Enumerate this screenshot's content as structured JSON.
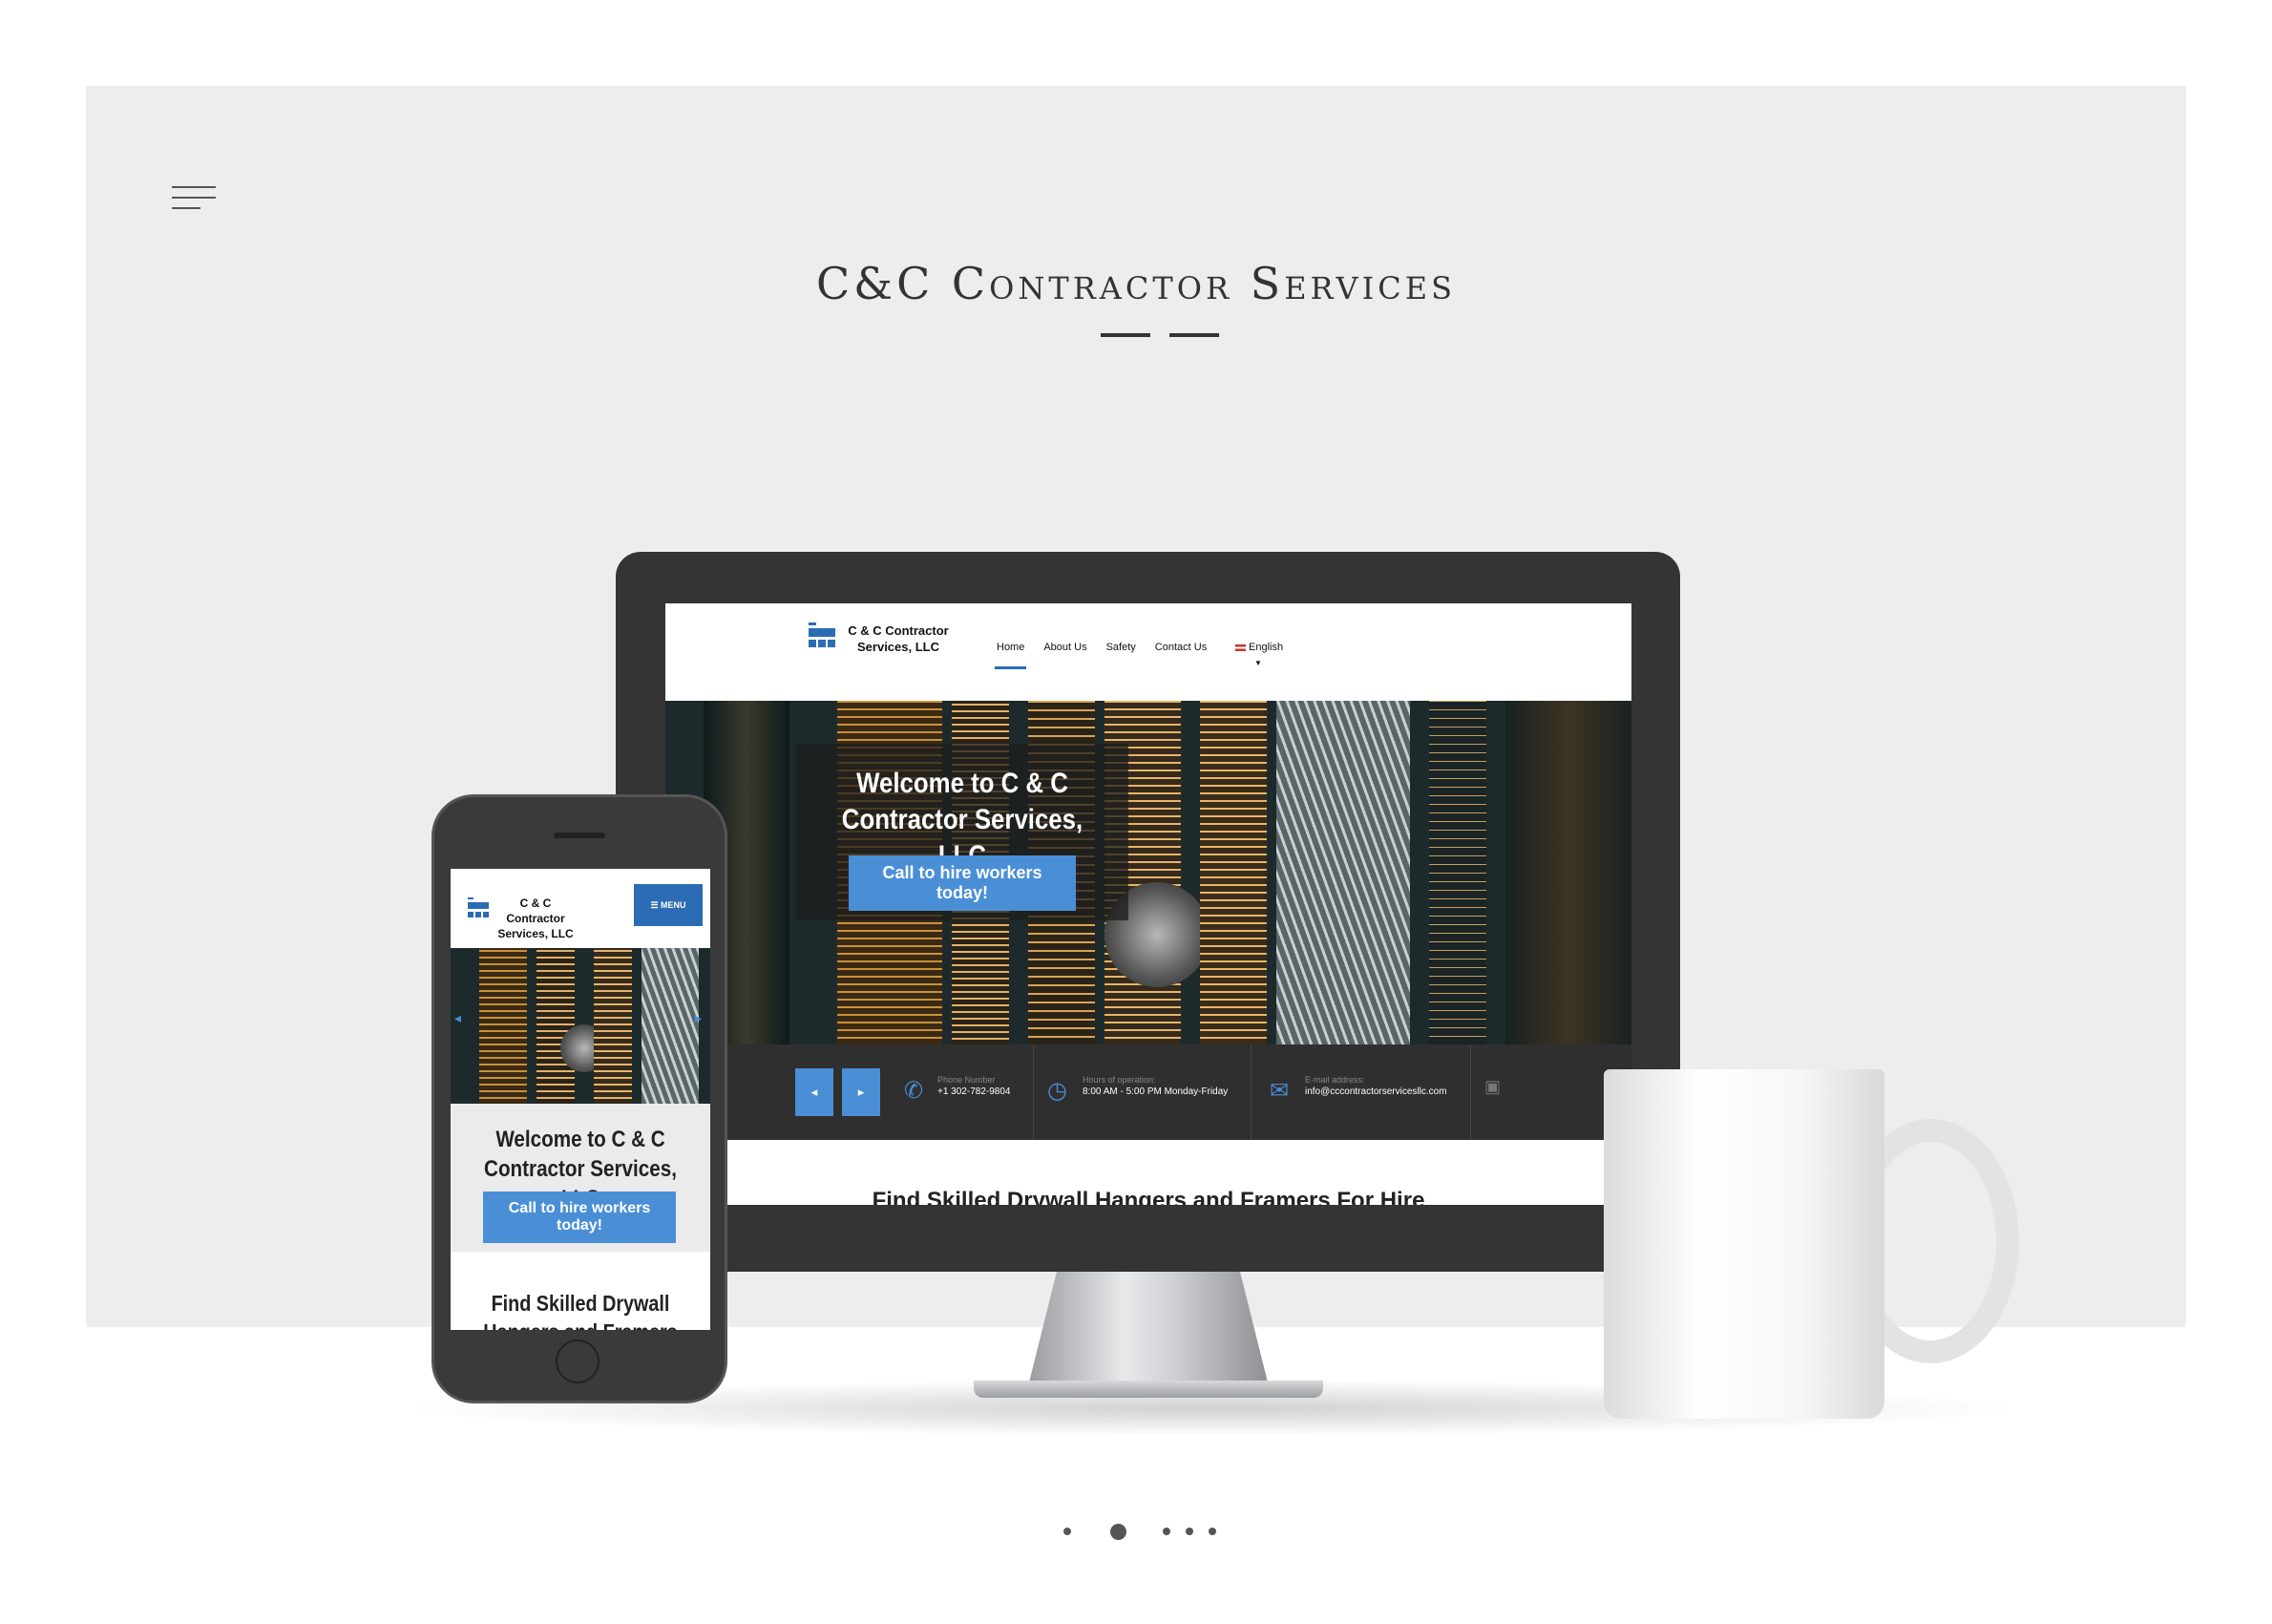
{
  "site_title": "C&C Contractor Services",
  "desktop": {
    "logo_line1": "C & C Contractor",
    "logo_line2": "Services, LLC",
    "nav": [
      "Home",
      "About Us",
      "Safety",
      "Contact Us"
    ],
    "language": "English",
    "hero_title_line1": "Welcome to C & C",
    "hero_title_line2": "Contractor Services, LLC",
    "hero_button": "Call to hire workers today!",
    "info": {
      "phone_label": "Phone Number",
      "phone_value": "+1 302-782-9804",
      "hours_label": "Hours of operation:",
      "hours_value": "8:00 AM - 5:00 PM Monday-Friday",
      "email_label": "E-mail address:",
      "email_value": "info@cccontractorservicesllc.com"
    },
    "section_title": "Find Skilled Drywall Hangers and Framers For Hire"
  },
  "mobile": {
    "logo_line1": "C & C Contractor",
    "logo_line2": "Services, LLC",
    "menu_label": "MENU",
    "welcome_line1": "Welcome to C & C",
    "welcome_line2": "Contractor Services, LLC",
    "button": "Call to hire workers today!",
    "section_line1": "Find Skilled Drywall",
    "section_line2": "Hangers and Framers For"
  },
  "carousel": {
    "total": 5,
    "active_index": 1
  },
  "colors": {
    "accent": "#4a8fd6",
    "panel_bg": "#ededed",
    "device_frame": "#343434"
  }
}
